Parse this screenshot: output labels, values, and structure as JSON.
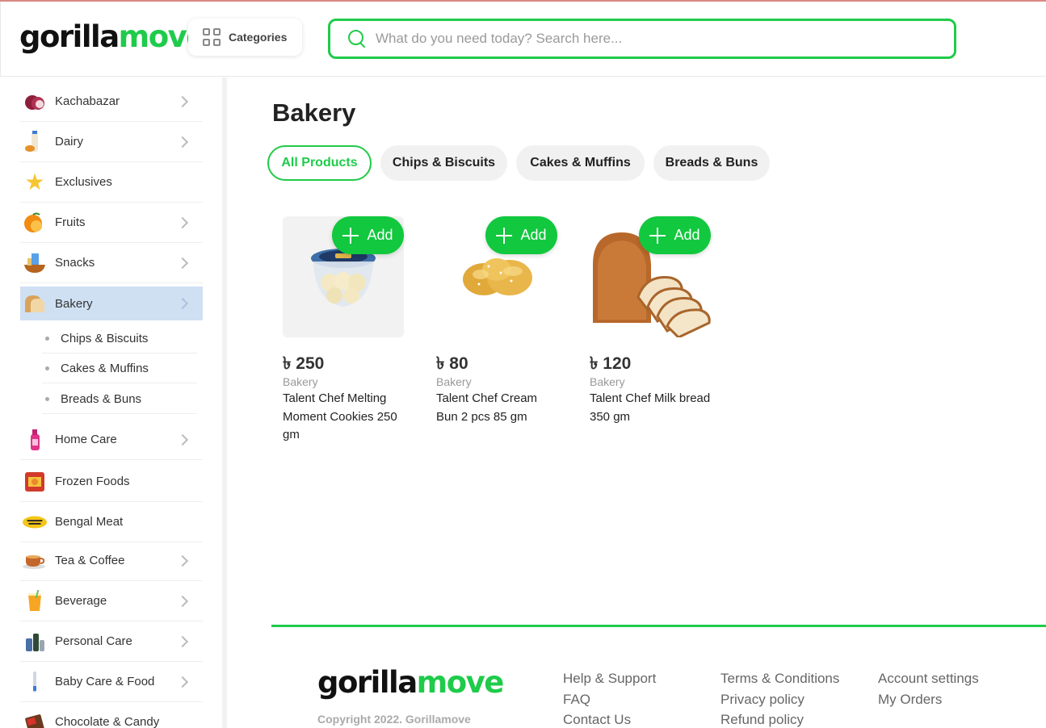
{
  "header": {
    "logo_part1": "gorilla",
    "logo_part2": "move",
    "categories_label": "Categories",
    "search_placeholder": "What do you need today? Search here..."
  },
  "sidebar": {
    "items": [
      {
        "label": "Kachabazar",
        "icon": "onion-icon",
        "chevron": true
      },
      {
        "label": "Dairy",
        "icon": "milk-bottle-icon",
        "chevron": true
      },
      {
        "label": "Exclusives",
        "icon": "star-icon",
        "chevron": false
      },
      {
        "label": "Fruits",
        "icon": "orange-icon",
        "chevron": true
      },
      {
        "label": "Snacks",
        "icon": "snack-bowl-icon",
        "chevron": true
      },
      {
        "label": "Bakery",
        "icon": "bread-icon",
        "chevron": true,
        "active": true
      },
      {
        "label": "Home Care",
        "icon": "detergent-bottle-icon",
        "chevron": true
      },
      {
        "label": "Frozen Foods",
        "icon": "frozen-pack-icon",
        "chevron": false
      },
      {
        "label": "Bengal Meat",
        "icon": "bengal-meat-logo-icon",
        "chevron": false
      },
      {
        "label": "Tea & Coffee",
        "icon": "tea-cup-icon",
        "chevron": true
      },
      {
        "label": "Beverage",
        "icon": "juice-glass-icon",
        "chevron": true
      },
      {
        "label": "Personal Care",
        "icon": "personal-care-bottles-icon",
        "chevron": true
      },
      {
        "label": "Baby Care & Food",
        "icon": "baby-bottle-icon",
        "chevron": true
      },
      {
        "label": "Chocolate & Candy",
        "icon": "chocolate-icon",
        "chevron": false
      }
    ],
    "sub_items": [
      "Chips & Biscuits",
      "Cakes & Muffins",
      "Breads & Buns"
    ]
  },
  "main": {
    "title": "Bakery",
    "tabs": [
      {
        "label": "All Products",
        "active": true
      },
      {
        "label": "Chips & Biscuits",
        "active": false
      },
      {
        "label": "Cakes & Muffins",
        "active": false
      },
      {
        "label": "Breads & Buns",
        "active": false
      }
    ],
    "add_label": "Add",
    "products": [
      {
        "price": "৳ 250",
        "category": "Bakery",
        "name": "Talent Chef Melting Moment Cookies 250 gm",
        "image": "cookie-jar-image"
      },
      {
        "price": "৳ 80",
        "category": "Bakery",
        "name": "Talent Chef Cream Bun 2 pcs 85 gm",
        "image": "cream-bun-image"
      },
      {
        "price": "৳ 120",
        "category": "Bakery",
        "name": "Talent Chef Milk bread 350 gm",
        "image": "milk-bread-image"
      }
    ]
  },
  "footer": {
    "logo_part1": "gorilla",
    "logo_part2": "move",
    "copyright": "Copyright 2022. Gorillamove",
    "col1": [
      "Help & Support",
      "FAQ",
      "Contact Us"
    ],
    "col2": [
      "Terms & Conditions",
      "Privacy policy",
      "Refund policy"
    ],
    "col3": [
      "Account settings",
      "My Orders"
    ]
  },
  "colors": {
    "accent": "#1fcb4a",
    "add_button": "#12c83e",
    "active_sidebar": "#cfe0f3"
  }
}
